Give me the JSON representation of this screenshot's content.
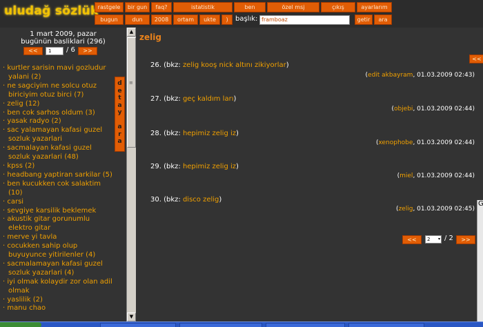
{
  "logo": "uludağ sözlük",
  "nav": {
    "row1": [
      "rastgele",
      "bir gun",
      "faq?",
      "istatistik",
      "ben",
      "özel msj",
      "çıkış",
      "ayarlarım"
    ],
    "row2": [
      "bugun",
      "dun",
      "2008",
      "ortam",
      "ukte",
      ")"
    ],
    "search_label": "başlık:",
    "search_value": "framboaz",
    "search_buttons": [
      "getir",
      "ara"
    ]
  },
  "left": {
    "date": "1 mart 2009, pazar",
    "today_topics": "bugünün basliklari (296)",
    "prev": "<<",
    "next": ">>",
    "page_value": "1",
    "page_total": "/ 6",
    "detay_tab": [
      "d",
      "e",
      "t",
      "a",
      "y",
      "",
      "a",
      "r",
      "a"
    ],
    "topics": [
      {
        "t": "kurtler sarisin mavi gozludur yalani",
        "c": "(2)"
      },
      {
        "t": "ne sagciyim ne solcu otuz biriciyim otuz birci",
        "c": "(7)"
      },
      {
        "t": "zelig",
        "c": "(12)"
      },
      {
        "t": "ben cok sarhos oldum",
        "c": "(3)"
      },
      {
        "t": "yasak radyo",
        "c": "(2)"
      },
      {
        "t": "sac yalamayan kafasi guzel sozluk yazarlari",
        "c": ""
      },
      {
        "t": "sacmalayan kafasi guzel sozluk yazarlari",
        "c": "(48)"
      },
      {
        "t": "kpss",
        "c": "(2)"
      },
      {
        "t": "headbang yaptiran sarkilar",
        "c": "(5)"
      },
      {
        "t": "ben kucukken cok salaktim",
        "c": "(10)"
      },
      {
        "t": "carsi",
        "c": ""
      },
      {
        "t": "sevgiye karsilik beklemek",
        "c": ""
      },
      {
        "t": "akustik gitar gorunumlu elektro gitar",
        "c": ""
      },
      {
        "t": "merve yi tavla",
        "c": ""
      },
      {
        "t": "cocukken sahip olup buyuyunce yitirilenler",
        "c": "(4)"
      },
      {
        "t": "sacmalamayan kafasi guzel sozluk yazarlari",
        "c": "(4)"
      },
      {
        "t": "iyi olmak kolaydir zor olan adil olmak",
        "c": ""
      },
      {
        "t": "yaslilik",
        "c": "(2)"
      },
      {
        "t": "manu chao",
        "c": ""
      }
    ]
  },
  "main": {
    "topic_title": "zelig",
    "top_nav": "<<",
    "entries": [
      {
        "num": "26.",
        "pre": "(bkz: ",
        "link": "zelig kooş nick altını zikiyorlar",
        "post": ")",
        "author": "edit akbayram",
        "date": ", 01.03.2009 02:43)"
      },
      {
        "num": "27.",
        "pre": "(bkz: ",
        "link": "geç kaldım ları",
        "post": ")",
        "author": "objebi",
        "date": ", 01.03.2009 02:44)"
      },
      {
        "num": "28.",
        "pre": "(bkz: ",
        "link": "hepimiz zelig iz",
        "post": ")",
        "author": "xenophobe",
        "date": ", 01.03.2009 02:44)"
      },
      {
        "num": "29.",
        "pre": "(bkz: ",
        "link": "hepimiz zelig iz",
        "post": ")",
        "author": "miel",
        "date": ", 01.03.2009 02:44)"
      },
      {
        "num": "30.",
        "pre": "(bkz: ",
        "link": "disco zelig",
        "post": ")",
        "author": "zelig",
        "date": ", 01.03.2009 02:45)"
      }
    ],
    "pager": {
      "prev": "<<",
      "next": ">>",
      "page_value": "2",
      "page_total": "/ 2"
    }
  },
  "colors": {
    "accent": "#e15d05",
    "link": "#f0a000",
    "bg": "#333333"
  }
}
